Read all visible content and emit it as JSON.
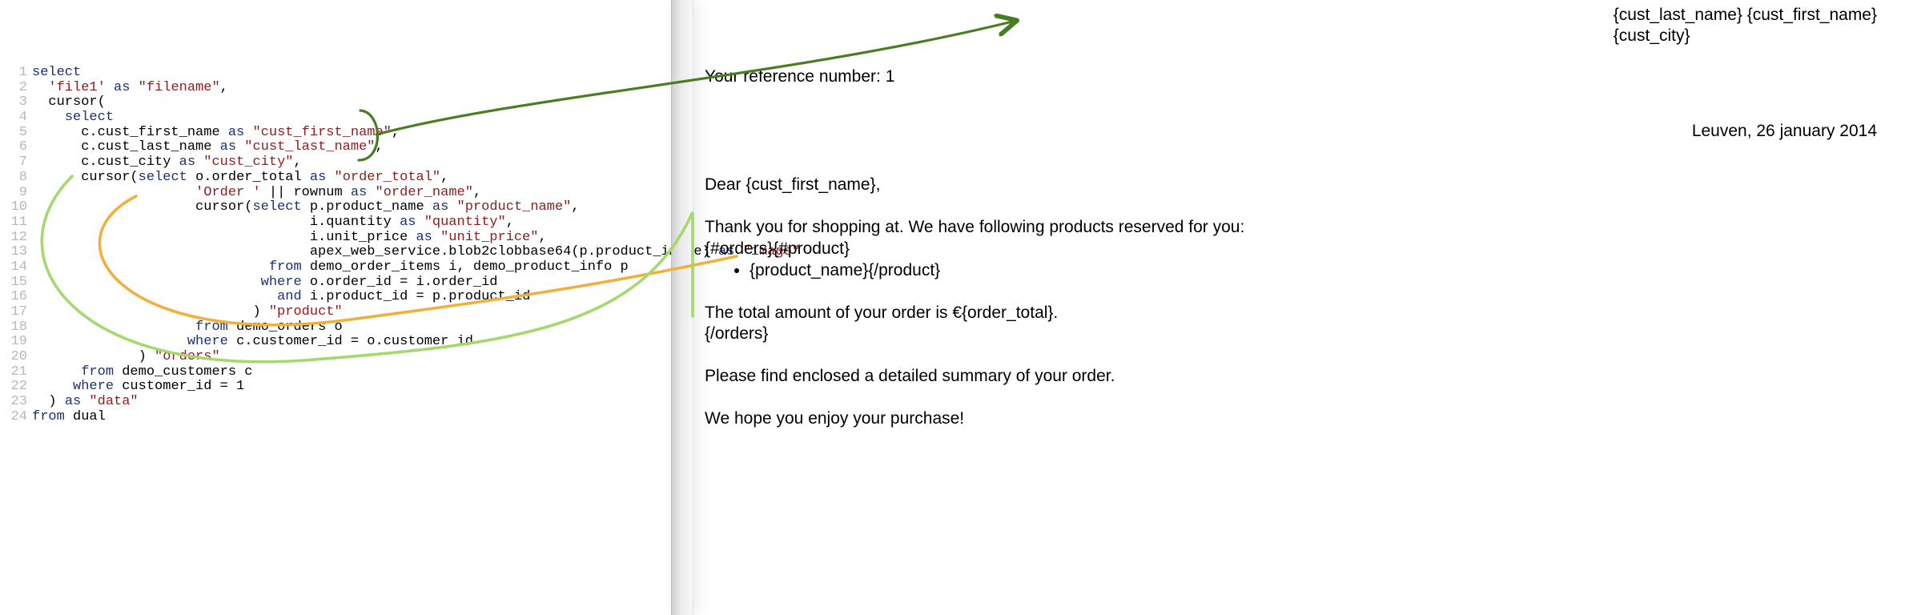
{
  "code": {
    "lines": [
      {
        "n": 1,
        "tokens": [
          [
            "",
            "kw",
            "select"
          ]
        ]
      },
      {
        "n": 2,
        "tokens": [
          [
            "  ",
            "str",
            "'file1'"
          ],
          [
            " ",
            "kw",
            "as"
          ],
          [
            " ",
            "str",
            "\"filename\""
          ],
          [
            ",",
            "",
            ""
          ]
        ]
      },
      {
        "n": 3,
        "tokens": [
          [
            "  ",
            "id",
            "cursor("
          ]
        ]
      },
      {
        "n": 4,
        "tokens": [
          [
            "    ",
            "kw",
            "select"
          ]
        ]
      },
      {
        "n": 5,
        "tokens": [
          [
            "      ",
            "id",
            "c.cust_first_name "
          ],
          [
            "",
            "kw",
            "as"
          ],
          [
            " ",
            "str",
            "\"cust_first_name\""
          ],
          [
            ",",
            "",
            ""
          ]
        ]
      },
      {
        "n": 6,
        "tokens": [
          [
            "      ",
            "id",
            "c.cust_last_name "
          ],
          [
            "",
            "kw",
            "as"
          ],
          [
            " ",
            "str",
            "\"cust_last_name\""
          ],
          [
            ",",
            "",
            ""
          ]
        ]
      },
      {
        "n": 7,
        "tokens": [
          [
            "      ",
            "id",
            "c.cust_city "
          ],
          [
            "",
            "kw",
            "as"
          ],
          [
            " ",
            "str",
            "\"cust_city\""
          ],
          [
            ",",
            "",
            ""
          ]
        ]
      },
      {
        "n": 8,
        "tokens": [
          [
            "      ",
            "id",
            "cursor("
          ],
          [
            "",
            "kw",
            "select"
          ],
          [
            " ",
            "id",
            "o.order_total "
          ],
          [
            "",
            "kw",
            "as"
          ],
          [
            " ",
            "str",
            "\"order_total\""
          ],
          [
            ",",
            "",
            ""
          ]
        ]
      },
      {
        "n": 9,
        "tokens": [
          [
            "                    ",
            "str",
            "'Order '"
          ],
          [
            " ",
            "id",
            "|| rownum "
          ],
          [
            "",
            "kw",
            "as"
          ],
          [
            " ",
            "str",
            "\"order_name\""
          ],
          [
            ",",
            "",
            ""
          ]
        ]
      },
      {
        "n": 10,
        "tokens": [
          [
            "                    ",
            "id",
            "cursor("
          ],
          [
            "",
            "kw",
            "select"
          ],
          [
            " ",
            "id",
            "p.product_name "
          ],
          [
            "",
            "kw",
            "as"
          ],
          [
            " ",
            "str",
            "\"product_name\""
          ],
          [
            ",",
            "",
            ""
          ]
        ]
      },
      {
        "n": 11,
        "tokens": [
          [
            "                                  ",
            "id",
            "i.quantity "
          ],
          [
            "",
            "kw",
            "as"
          ],
          [
            " ",
            "str",
            "\"quantity\""
          ],
          [
            ",",
            "",
            ""
          ]
        ]
      },
      {
        "n": 12,
        "tokens": [
          [
            "                                  ",
            "id",
            "i.unit_price "
          ],
          [
            "",
            "kw",
            "as"
          ],
          [
            " ",
            "str",
            "\"unit_price\""
          ],
          [
            ",",
            "",
            ""
          ]
        ]
      },
      {
        "n": 13,
        "tokens": [
          [
            "                                  ",
            "id",
            "apex_web_service.blob2clobbase64(p.product_image) "
          ],
          [
            "",
            "kw",
            "as"
          ],
          [
            " ",
            "str",
            "\"image\""
          ]
        ]
      },
      {
        "n": 14,
        "tokens": [
          [
            "                             ",
            "kw",
            "from"
          ],
          [
            " ",
            "id",
            "demo_order_items i, demo_product_info p"
          ]
        ]
      },
      {
        "n": 15,
        "tokens": [
          [
            "                            ",
            "kw",
            "where"
          ],
          [
            " ",
            "id",
            "o.order_id = i.order_id"
          ]
        ]
      },
      {
        "n": 16,
        "tokens": [
          [
            "                              ",
            "kw",
            "and"
          ],
          [
            " ",
            "id",
            "i.product_id = p.product_id"
          ]
        ]
      },
      {
        "n": 17,
        "tokens": [
          [
            "                           ",
            "id",
            ") "
          ],
          [
            "",
            "str",
            "\"product\""
          ]
        ]
      },
      {
        "n": 18,
        "tokens": [
          [
            "                    ",
            "kw",
            "from"
          ],
          [
            " ",
            "id",
            "demo_orders o"
          ]
        ]
      },
      {
        "n": 19,
        "tokens": [
          [
            "                   ",
            "kw",
            "where"
          ],
          [
            " ",
            "id",
            "c.customer_id = o.customer_id"
          ]
        ]
      },
      {
        "n": 20,
        "tokens": [
          [
            "             ",
            "id",
            ") "
          ],
          [
            "",
            "str",
            "\"orders\""
          ]
        ]
      },
      {
        "n": 21,
        "tokens": [
          [
            "      ",
            "kw",
            "from"
          ],
          [
            " ",
            "id",
            "demo_customers c"
          ]
        ]
      },
      {
        "n": 22,
        "tokens": [
          [
            "     ",
            "kw",
            "where"
          ],
          [
            " ",
            "id",
            "customer_id = 1"
          ]
        ]
      },
      {
        "n": 23,
        "tokens": [
          [
            "  ",
            "id",
            ") "
          ],
          [
            "",
            "kw",
            "as"
          ],
          [
            " ",
            "str",
            "\"data\""
          ]
        ]
      },
      {
        "n": 24,
        "tokens": [
          [
            "",
            "kw",
            "from"
          ],
          [
            " ",
            "id",
            "dual"
          ]
        ]
      }
    ]
  },
  "doc": {
    "top_right_line1": "{cust_last_name} {cust_first_name}",
    "top_right_line2": "{cust_city}",
    "ref_line": "Your reference number: 1",
    "date": "Leuven, 26 january 2014",
    "greeting": "Dear {cust_first_name},",
    "intro": "Thank you for shopping at. We have following products reserved for you:",
    "orders_open": "{#orders}{#product}",
    "product_li": "{product_name}{/product}",
    "total_line": "The total amount of your order is €{order_total}.",
    "orders_close": "{/orders}",
    "enclosed": "Please find enclosed a detailed summary of your order.",
    "closing": "We hope you enjoy your purchase!"
  },
  "annotations": {
    "dark_green": "#4a7d23",
    "orange": "#f0b03e",
    "light_green": "#a6d86e"
  }
}
